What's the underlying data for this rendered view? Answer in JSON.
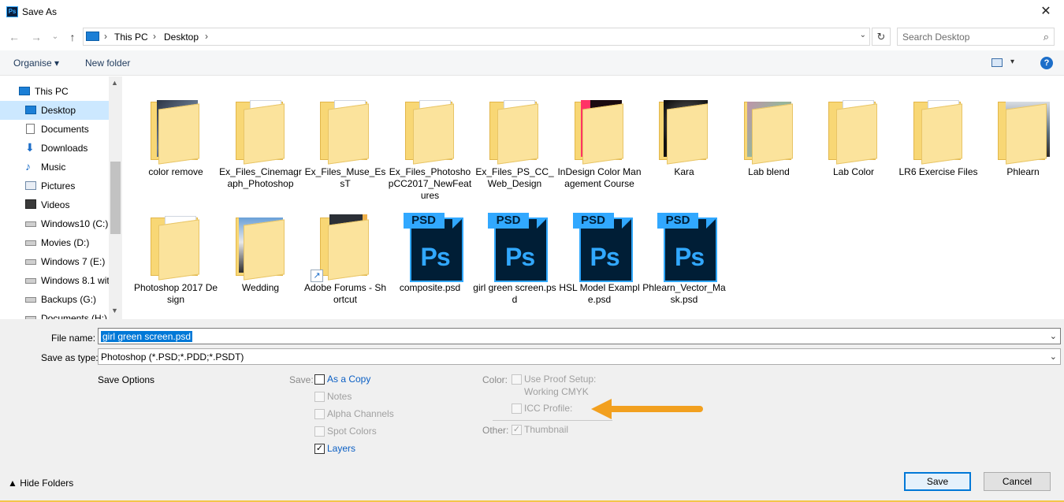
{
  "window": {
    "title": "Save As",
    "app_badge": "Ps",
    "close_glyph": "✕"
  },
  "nav": {
    "back_glyph": "←",
    "forward_glyph": "→",
    "recent_glyph": "⌄",
    "up_glyph": "↑",
    "breadcrumbs": [
      "This PC",
      "Desktop"
    ],
    "sep_glyph": "›",
    "drop_glyph": "⌄",
    "refresh_glyph": "↻"
  },
  "search": {
    "placeholder": "Search Desktop",
    "icon": "search-icon"
  },
  "toolbar": {
    "organise_label": "Organise ▾",
    "new_folder_label": "New folder",
    "view_drop_glyph": "▾",
    "help_glyph": "?"
  },
  "sidebar": {
    "items": [
      {
        "label": "This PC",
        "icon": "computer-icon"
      },
      {
        "label": "Desktop",
        "icon": "desktop-icon"
      },
      {
        "label": "Documents",
        "icon": "document-icon"
      },
      {
        "label": "Downloads",
        "icon": "download-icon"
      },
      {
        "label": "Music",
        "icon": "music-icon"
      },
      {
        "label": "Pictures",
        "icon": "pictures-icon"
      },
      {
        "label": "Videos",
        "icon": "video-icon"
      },
      {
        "label": "Windows10 (C:)",
        "icon": "drive-icon"
      },
      {
        "label": "Movies (D:)",
        "icon": "drive-icon"
      },
      {
        "label": "Windows 7 (E:)",
        "icon": "drive-icon"
      },
      {
        "label": "Windows 8.1 wit",
        "icon": "drive-icon"
      },
      {
        "label": "Backups (G:)",
        "icon": "drive-icon"
      },
      {
        "label": "Documents (H:)",
        "icon": "drive-icon"
      }
    ],
    "scroll_up_glyph": "▲",
    "scroll_down_glyph": "▼"
  },
  "files": [
    {
      "name": "color remove",
      "kind": "folder-dark"
    },
    {
      "name": "Ex_Files_Cinemagraph_Photoshop",
      "kind": "folder"
    },
    {
      "name": "Ex_Files_Muse_EssT",
      "kind": "folder"
    },
    {
      "name": "Ex_Files_PhotoshopCC2017_NewFeatures",
      "kind": "folder"
    },
    {
      "name": "Ex_Files_PS_CC_Web_Design",
      "kind": "folder"
    },
    {
      "name": "InDesign Color Management Course",
      "kind": "folder-indd"
    },
    {
      "name": "Kara",
      "kind": "folder-face"
    },
    {
      "name": "Lab blend",
      "kind": "folder-lab"
    },
    {
      "name": "Lab Color",
      "kind": "folder"
    },
    {
      "name": "LR6 Exercise Files",
      "kind": "folder"
    },
    {
      "name": "Phlearn",
      "kind": "folder-ph"
    },
    {
      "name": "Photoshop 2017 Design",
      "kind": "folder"
    },
    {
      "name": "Wedding",
      "kind": "folder-wed"
    },
    {
      "name": "Adobe Forums - Shortcut",
      "kind": "shortcut"
    },
    {
      "name": "composite.psd",
      "kind": "psd"
    },
    {
      "name": "girl green screen.psd",
      "kind": "psd"
    },
    {
      "name": "HSL Model Example.psd",
      "kind": "psd"
    },
    {
      "name": "Phlearn_Vector_Mask.psd",
      "kind": "psd"
    }
  ],
  "psd_badge": "PSD",
  "psd_mark": "Ps",
  "shortcut_glyph": "↗",
  "form": {
    "file_name_label": "File name:",
    "file_name_value": "girl green screen.psd",
    "save_type_label": "Save as type:",
    "save_type_value": "Photoshop (*.PSD;*.PDD;*.PSDT)",
    "drop_glyph": "⌄"
  },
  "options": {
    "title": "Save Options",
    "save_label": "Save:",
    "color_label": "Color:",
    "other_label": "Other:",
    "as_a_copy": "As a Copy",
    "notes": "Notes",
    "alpha_channels": "Alpha Channels",
    "spot_colors": "Spot Colors",
    "layers": "Layers",
    "use_proof_setup": "Use Proof Setup:",
    "working_cmyk": "Working CMYK",
    "icc_profile": "ICC Profile:",
    "thumbnail": "Thumbnail",
    "check_glyph": "✓"
  },
  "footer": {
    "hide_folders": "▲  Hide Folders",
    "save_button": "Save",
    "cancel_button": "Cancel"
  },
  "colors": {
    "accent": "#0078d7",
    "selection": "#cce8ff",
    "annotation_arrow": "#f2a01f",
    "ps_blue": "#31a8ff"
  }
}
